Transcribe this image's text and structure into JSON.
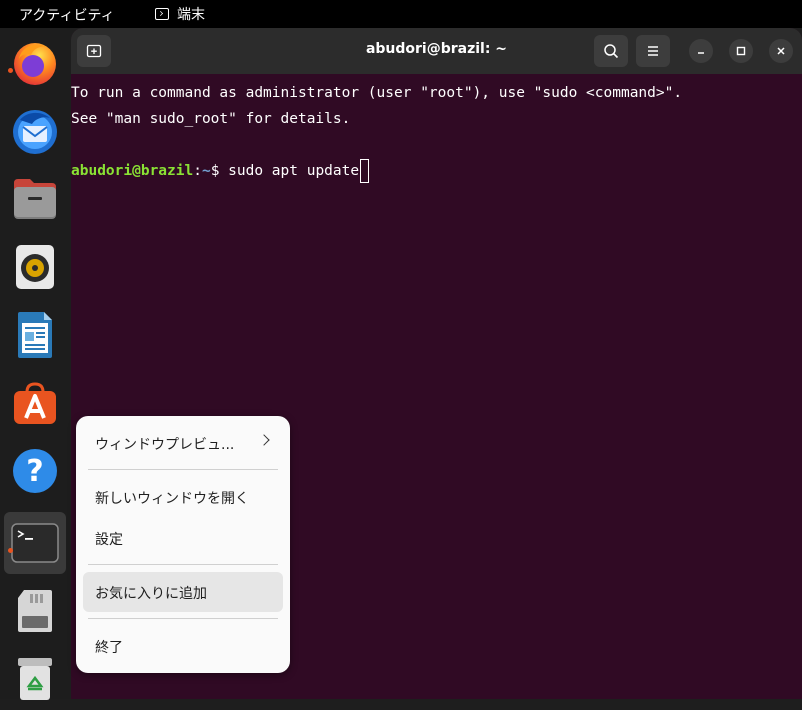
{
  "topbar": {
    "activities": "アクティビティ",
    "app_name": "端末"
  },
  "dock": {
    "items": [
      {
        "icon": "firefox-icon",
        "running": true
      },
      {
        "icon": "thunderbird-icon",
        "running": false
      },
      {
        "icon": "files-icon",
        "running": false
      },
      {
        "icon": "rhythmbox-icon",
        "running": false
      },
      {
        "icon": "libreoffice-writer-icon",
        "running": false
      },
      {
        "icon": "app-center-icon",
        "running": false
      },
      {
        "icon": "help-icon",
        "running": false
      },
      {
        "icon": "terminal-icon",
        "running": true
      },
      {
        "icon": "sd-card-icon",
        "running": false
      },
      {
        "icon": "trash-icon",
        "running": false
      }
    ]
  },
  "window": {
    "title": "abudori@brazil: ~"
  },
  "terminal": {
    "line1": "To run a command as administrator (user \"root\"), use \"sudo <command>\".",
    "line2": "See \"man sudo_root\" for details.",
    "prompt_user": "abudori@brazil",
    "prompt_sep": ":",
    "prompt_path": "~",
    "prompt_symbol": "$ ",
    "command": "sudo apt update"
  },
  "context_menu": {
    "items": [
      {
        "label": "ウィンドウプレビュ..."
      },
      {
        "label": "新しいウィンドウを開く"
      },
      {
        "label": "設定"
      },
      {
        "label": "お気に入りに追加"
      },
      {
        "label": "終了"
      }
    ]
  },
  "colors": {
    "terminal_bg": "#300a24",
    "accent": "#e95420",
    "prompt_user": "#8ae234",
    "prompt_path": "#729fcf"
  }
}
